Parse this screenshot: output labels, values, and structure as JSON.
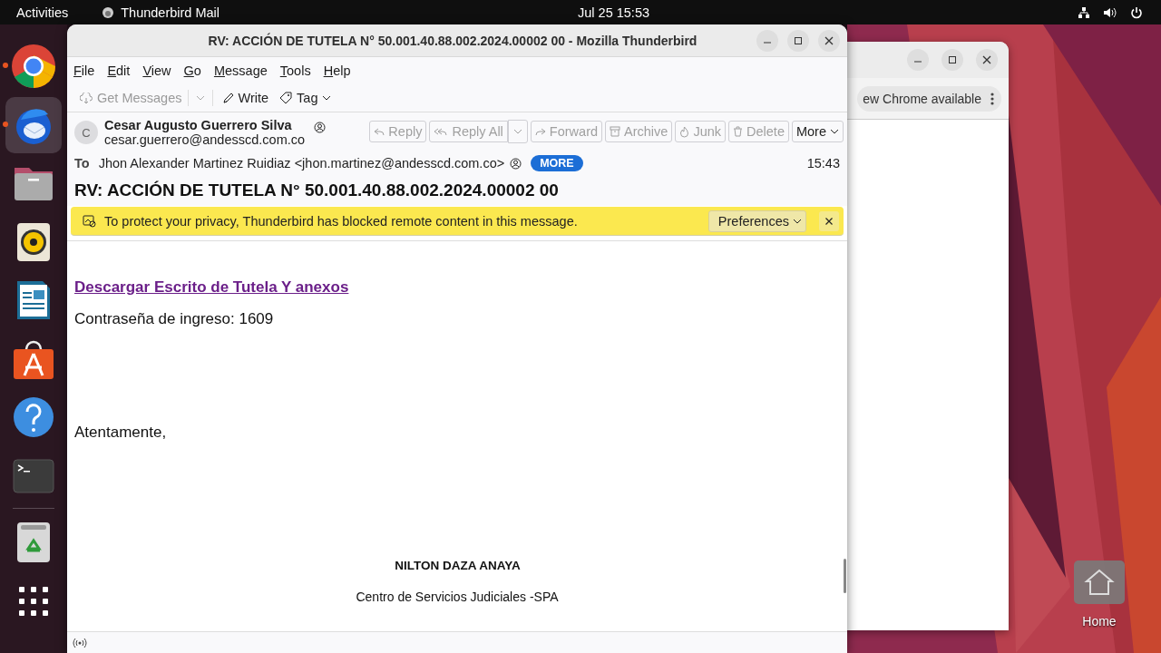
{
  "top_bar": {
    "activities": "Activities",
    "app_name": "Thunderbird Mail",
    "clock": "Jul 25  15:53"
  },
  "dock": {
    "items": [
      {
        "kind": "chrome",
        "running": true,
        "selected": false
      },
      {
        "kind": "thunderbird",
        "running": true,
        "selected": true
      },
      {
        "kind": "files",
        "running": false,
        "selected": false
      },
      {
        "kind": "rhythmbox",
        "running": false,
        "selected": false
      },
      {
        "kind": "writer",
        "running": false,
        "selected": false
      },
      {
        "kind": "appcenter",
        "running": false,
        "selected": false
      },
      {
        "kind": "help",
        "running": false,
        "selected": false
      },
      {
        "kind": "terminal",
        "running": false,
        "selected": false
      },
      {
        "kind": "trash",
        "running": false,
        "selected": false
      },
      {
        "kind": "apps",
        "running": false,
        "selected": false
      }
    ]
  },
  "background_window": {
    "update_button": "ew Chrome available"
  },
  "desktop_icons": [
    {
      "label": "Home"
    }
  ],
  "window": {
    "title": "RV: ACCIÓN DE TUTELA N° 50.001.40.88.002.2024.00002 00 - Mozilla Thunderbird",
    "menu": [
      "File",
      "Edit",
      "View",
      "Go",
      "Message",
      "Tools",
      "Help"
    ],
    "toolbar": [
      {
        "kind": "get",
        "label": "Get Messages",
        "disabled": true
      },
      {
        "kind": "write",
        "label": "Write",
        "disabled": false
      },
      {
        "kind": "tag",
        "label": "Tag",
        "disabled": false
      }
    ],
    "header": {
      "avatar_letter": "C",
      "from_name": "Cesar Augusto Guerrero Silva",
      "from_email": "cesar.guerrero@andesscd.com.co",
      "actions": [
        {
          "kind": "reply",
          "label": "Reply",
          "disabled": true
        },
        {
          "kind": "replyall",
          "label": "Reply All",
          "disabled": true
        },
        {
          "kind": "forward",
          "label": "Forward",
          "disabled": true
        },
        {
          "kind": "archive",
          "label": "Archive",
          "disabled": true
        },
        {
          "kind": "junk",
          "label": "Junk",
          "disabled": true
        },
        {
          "kind": "delete",
          "label": "Delete",
          "disabled": true
        },
        {
          "kind": "more",
          "label": "More",
          "disabled": false
        }
      ],
      "to_label": "To",
      "to": "Jhon Alexander Martinez Ruidiaz <jhon.martinez@andesscd.com.co>",
      "more_badge": "MORE",
      "time": "15:43",
      "subject": "RV: ACCIÓN DE TUTELA N° 50.001.40.88.002.2024.00002 00"
    },
    "notice": {
      "text": "To protect your privacy, Thunderbird has blocked remote content in this message.",
      "button": "Preferences"
    },
    "body": {
      "link": "Descargar Escrito de Tutela Y anexos",
      "password": "Contraseña de ingreso: 1609",
      "closing": "Atentamente,",
      "signature_name": "NILTON DAZA ANAYA",
      "signature_org": "Centro de Servicios Judiciales -SPA"
    }
  }
}
